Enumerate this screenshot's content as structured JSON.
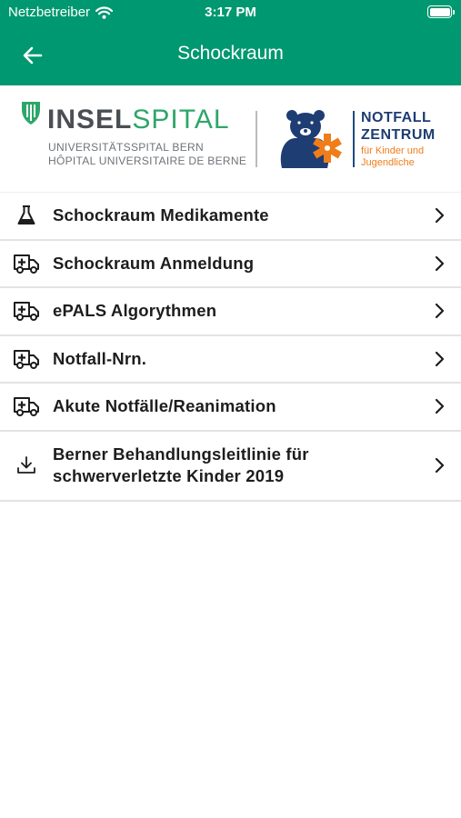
{
  "status_bar": {
    "carrier": "Netzbetreiber",
    "time": "3:17 PM",
    "icons": [
      "wifi-icon",
      "battery-icon"
    ]
  },
  "nav": {
    "title": "Schockraum",
    "back_icon": "arrow-left-icon"
  },
  "logos": {
    "insel_bold": "INSEL",
    "insel_light": "SPITAL",
    "insel_line1": "UNIVERSITÄTSSPITAL BERN",
    "insel_line2": "HÔPITAL UNIVERSITAIRE DE BERNE",
    "notfall_line1": "NOTFALL",
    "notfall_line2": "ZENTRUM",
    "notfall_sub1": "für Kinder und",
    "notfall_sub2": "Jugendliche"
  },
  "menu": {
    "items": [
      {
        "label": "Schockraum Medikamente",
        "icon": "flask-icon"
      },
      {
        "label": "Schockraum Anmeldung",
        "icon": "ambulance-icon"
      },
      {
        "label": "ePALS Algorythmen",
        "icon": "ambulance-icon"
      },
      {
        "label": "Notfall-Nrn.",
        "icon": "ambulance-icon"
      },
      {
        "label": "Akute Notfälle/Reanimation",
        "icon": "ambulance-icon"
      },
      {
        "label": "Berner Behandlungsleitlinie für schwerverletzte Kinder 2019",
        "icon": "download-icon"
      }
    ]
  },
  "colors": {
    "header": "#009870",
    "insel_green": "#2ea66a",
    "notfall_blue": "#1e3d73",
    "notfall_orange": "#f07d1a"
  }
}
